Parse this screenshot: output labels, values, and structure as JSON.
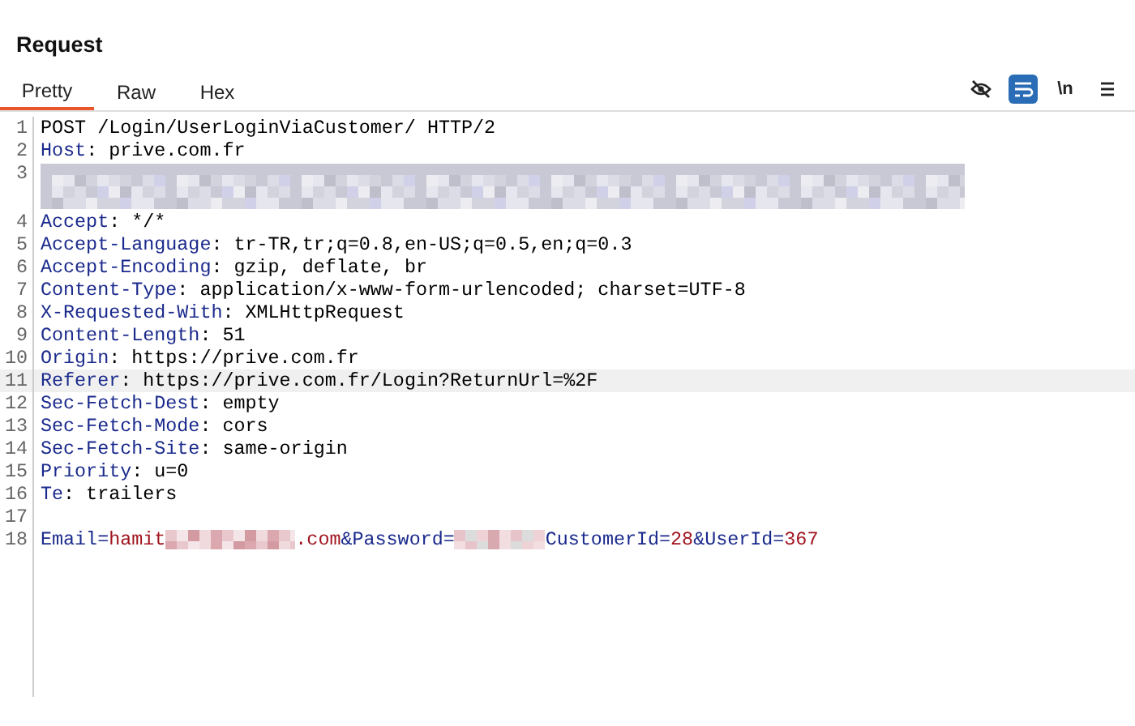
{
  "panel": {
    "title": "Request"
  },
  "tabs": [
    {
      "label": "Pretty",
      "selected": true
    },
    {
      "label": "Raw",
      "selected": false
    },
    {
      "label": "Hex",
      "selected": false
    }
  ],
  "toolbar": [
    {
      "kind": "hide",
      "on": false
    },
    {
      "kind": "wrap",
      "on": true
    },
    {
      "kind": "text",
      "text": "\\n",
      "on": false
    },
    {
      "kind": "menu",
      "on": false
    }
  ],
  "lines": [
    {
      "number": "1",
      "highlighted": false,
      "segments": [
        {
          "kind": "plain",
          "text": "POST /Login/UserLoginViaCustomer/ HTTP/2"
        }
      ]
    },
    {
      "number": "2",
      "highlighted": false,
      "segments": [
        {
          "kind": "key",
          "text": "Host"
        },
        {
          "kind": "plain",
          "text": ": prive.com.fr"
        }
      ]
    },
    {
      "number": "3",
      "highlighted": false,
      "segments": [
        {
          "kind": "redacted-block"
        }
      ]
    },
    {
      "number": "4",
      "highlighted": false,
      "segments": [
        {
          "kind": "key",
          "text": "Accept"
        },
        {
          "kind": "plain",
          "text": ": */*"
        }
      ]
    },
    {
      "number": "5",
      "highlighted": false,
      "segments": [
        {
          "kind": "key",
          "text": "Accept-Language"
        },
        {
          "kind": "plain",
          "text": ": tr-TR,tr;q=0.8,en-US;q=0.5,en;q=0.3"
        }
      ]
    },
    {
      "number": "6",
      "highlighted": false,
      "segments": [
        {
          "kind": "key",
          "text": "Accept-Encoding"
        },
        {
          "kind": "plain",
          "text": ": gzip, deflate, br"
        }
      ]
    },
    {
      "number": "7",
      "highlighted": false,
      "segments": [
        {
          "kind": "key",
          "text": "Content-Type"
        },
        {
          "kind": "plain",
          "text": ": application/x-www-form-urlencoded; charset=UTF-8"
        }
      ]
    },
    {
      "number": "8",
      "highlighted": false,
      "segments": [
        {
          "kind": "key",
          "text": "X-Requested-With"
        },
        {
          "kind": "plain",
          "text": ": XMLHttpRequest"
        }
      ]
    },
    {
      "number": "9",
      "highlighted": false,
      "segments": [
        {
          "kind": "key",
          "text": "Content-Length"
        },
        {
          "kind": "plain",
          "text": ": 51"
        }
      ]
    },
    {
      "number": "10",
      "highlighted": false,
      "segments": [
        {
          "kind": "key",
          "text": "Origin"
        },
        {
          "kind": "plain",
          "text": ": https://prive.com.fr"
        }
      ]
    },
    {
      "number": "11",
      "highlighted": true,
      "segments": [
        {
          "kind": "key",
          "text": "Referer"
        },
        {
          "kind": "plain",
          "text": ": https://prive.com.fr/Login?ReturnUrl=%2F"
        }
      ]
    },
    {
      "number": "12",
      "highlighted": false,
      "segments": [
        {
          "kind": "key",
          "text": "Sec-Fetch-Dest"
        },
        {
          "kind": "plain",
          "text": ": empty"
        }
      ]
    },
    {
      "number": "13",
      "highlighted": false,
      "segments": [
        {
          "kind": "key",
          "text": "Sec-Fetch-Mode"
        },
        {
          "kind": "plain",
          "text": ": cors"
        }
      ]
    },
    {
      "number": "14",
      "highlighted": false,
      "segments": [
        {
          "kind": "key",
          "text": "Sec-Fetch-Site"
        },
        {
          "kind": "plain",
          "text": ": same-origin"
        }
      ]
    },
    {
      "number": "15",
      "highlighted": false,
      "segments": [
        {
          "kind": "key",
          "text": "Priority"
        },
        {
          "kind": "plain",
          "text": ": u=0"
        }
      ]
    },
    {
      "number": "16",
      "highlighted": false,
      "segments": [
        {
          "kind": "key",
          "text": "Te"
        },
        {
          "kind": "plain",
          "text": ": trailers"
        }
      ]
    },
    {
      "number": "17",
      "highlighted": false
    },
    {
      "number": "18",
      "highlighted": false,
      "segments": [
        {
          "kind": "param",
          "text": "Email="
        },
        {
          "kind": "value",
          "text": "hamit"
        },
        {
          "kind": "redacted-long"
        },
        {
          "kind": "value",
          "text": ".com"
        },
        {
          "kind": "param",
          "text": "&Password="
        },
        {
          "kind": "redacted-short"
        },
        {
          "kind": "param",
          "text": "CustomerId="
        },
        {
          "kind": "value",
          "text": "28"
        },
        {
          "kind": "param",
          "text": "&UserId="
        },
        {
          "kind": "value",
          "text": "367"
        }
      ]
    }
  ]
}
